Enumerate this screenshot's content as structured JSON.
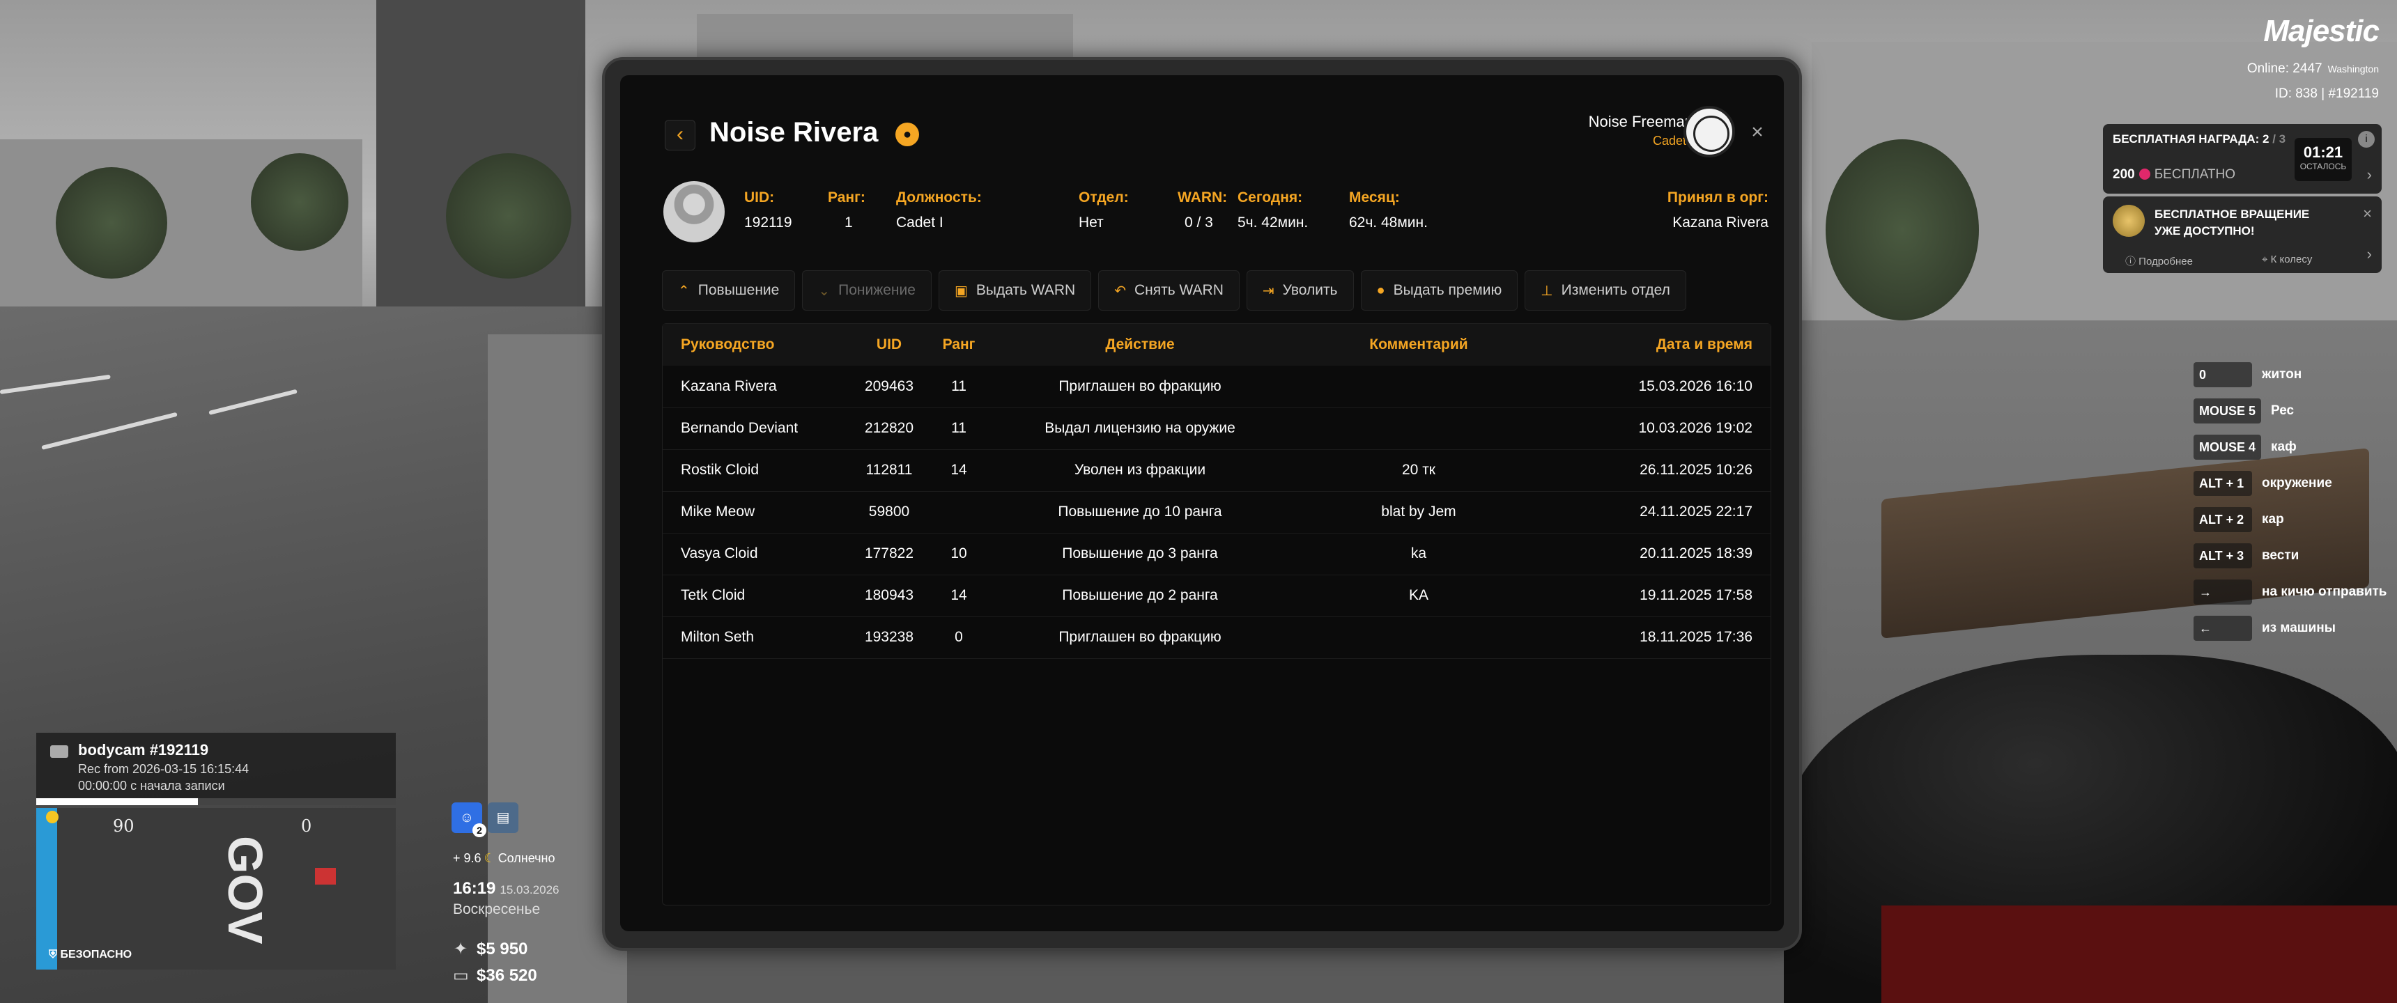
{
  "hud": {
    "logo": "Majestic",
    "online": "Online: 2447",
    "city": "Washington",
    "id_line": "ID: 838 | #192119",
    "reward": {
      "title": "БЕСПЛАТНАЯ НАГРАДА: 2",
      "title_sub": "/ 3",
      "coins": "200",
      "coins_label": "БЕСПЛАТНО",
      "timer": "01:21",
      "timer_label": "ОСТАЛОСЬ"
    },
    "spin": {
      "title_line1": "БЕСПЛАТНОЕ ВРАЩЕНИЕ",
      "title_line2": "УЖЕ ДОСТУПНО!",
      "more": "Подробнее",
      "to_wheel": "К колесу"
    },
    "binds": [
      {
        "key": "0",
        "label": "житон"
      },
      {
        "key": "MOUSE 5",
        "label": "Рес"
      },
      {
        "key": "MOUSE 4",
        "label": "каф"
      },
      {
        "key": "ALT + 1",
        "label": "окружение"
      },
      {
        "key": "ALT + 2",
        "label": "кар"
      },
      {
        "key": "ALT + 3",
        "label": "вести"
      },
      {
        "key": "→",
        "label": "на кичю отправить"
      },
      {
        "key": "←",
        "label": "из машины"
      }
    ],
    "bodycam": {
      "title": "bodycam #192119",
      "rec": "Rec from 2026-03-15 16:15:44",
      "elapsed": "00:00:00 с начала записи",
      "progress": 0.45
    },
    "minimap": {
      "left_num": "90",
      "right_num": "0",
      "district": "GOV",
      "safe": "БЕЗОПАСНО"
    },
    "status_count": "2",
    "weather": "+ 9.6",
    "weather_label": "Солнечно",
    "time": "16:19",
    "date": "15.03.2026",
    "weekday": "Воскресенье",
    "cash": "$5 950",
    "bank": "$36 520"
  },
  "tablet": {
    "player_name": "Noise Rivera",
    "officer_name": "Noise Freeman",
    "officer_rank": "Cadet I",
    "info": {
      "uid_k": "UID:",
      "uid_v": "192119",
      "rank_k": "Ранг:",
      "rank_v": "1",
      "position_k": "Должность:",
      "position_v": "Cadet I",
      "dept_k": "Отдел:",
      "dept_v": "Нет",
      "warn_k": "WARN:",
      "warn_v": "0 / 3",
      "today_k": "Сегодня:",
      "today_v": "5ч. 42мин.",
      "month_k": "Месяц:",
      "month_v": "62ч. 48мин.",
      "accepted_k": "Принял в орг:",
      "accepted_v": "Kazana Rivera"
    },
    "actions": {
      "promote": "Повышение",
      "demote": "Понижение",
      "give_warn": "Выдать WARN",
      "remove_warn": "Снять WARN",
      "fire": "Уволить",
      "bonus": "Выдать премию",
      "change_dept": "Изменить отдел"
    },
    "table": {
      "headers": [
        "Руководство",
        "UID",
        "Ранг",
        "Действие",
        "Комментарий",
        "Дата и время"
      ],
      "rows": [
        [
          "Kazana Rivera",
          "209463",
          "11",
          "Приглашен во фракцию",
          "",
          "15.03.2026 16:10"
        ],
        [
          "Bernando Deviant",
          "212820",
          "11",
          "Выдал лицензию на оружие",
          "",
          "10.03.2026 19:02"
        ],
        [
          "Rostik Cloid",
          "112811",
          "14",
          "Уволен из фракции",
          "20 тк",
          "26.11.2025 10:26"
        ],
        [
          "Mike Meow",
          "59800",
          "",
          "Повышение до 10 ранга",
          "blat by Jem",
          "24.11.2025 22:17"
        ],
        [
          "Vasya Cloid",
          "177822",
          "10",
          "Повышение до 3 ранга",
          "ka",
          "20.11.2025 18:39"
        ],
        [
          "Tetk Cloid",
          "180943",
          "14",
          "Повышение до 2 ранга",
          "KA",
          "19.11.2025 17:58"
        ],
        [
          "Milton Seth",
          "193238",
          "0",
          "Приглашен во фракцию",
          "",
          "18.11.2025 17:36"
        ]
      ]
    }
  }
}
